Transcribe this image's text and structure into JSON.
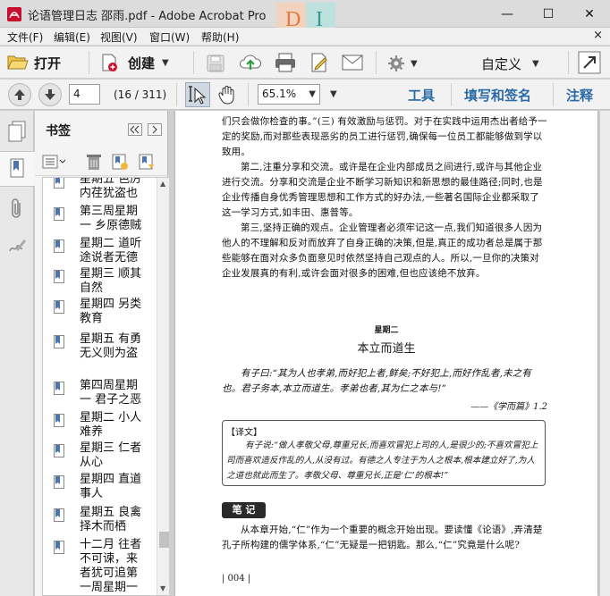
{
  "window": {
    "title": "论语管理日志 邵雨.pdf - Adobe Acrobat Pro",
    "watermark": "DI",
    "controls": {
      "minimize": "—",
      "maximize": "☐",
      "close": "✕"
    }
  },
  "menu": {
    "items": [
      "文件(F)",
      "编辑(E)",
      "视图(V)",
      "窗口(W)",
      "帮助(H)"
    ],
    "close_doc": "×"
  },
  "toolbar": {
    "open_label": "打开",
    "create_label": "创建",
    "custom_label": "自定义"
  },
  "nav": {
    "page_value": "4",
    "page_info": "(16 / 311)",
    "zoom_value": "65.1%",
    "tools_label": "工具",
    "fill_sign_label": "填写和签名",
    "comment_label": "注释"
  },
  "bookmarks": {
    "title": "书签",
    "items": [
      "星期五 色厉内荏犹盗也",
      "第三周星期一 乡原德贼",
      "星期二 道听途说者无德",
      "星期三 顺其自然",
      "星期四 另类教育",
      "星期五 有勇无义则为盗",
      "第四周星期一 君子之恶",
      "星期二 小人难养",
      "星期三 仁者从心",
      "星期四 直道事人",
      "星期五 良禽择木而栖",
      "十二月 往者不可谏，来者犹可追第一周星期一"
    ]
  },
  "document": {
    "para1": "们只会做你检查的事。”(三) 有效激励与惩罚。对于在实践中运用杰出者给予一定的奖励,而对那些表现恶劣的员工进行惩罚,确保每一位员工都能够做到学以致用。",
    "para2": "第二,注重分享和交流。或许是在企业内部成员之间进行,或许与其他企业进行交流。分享和交流是企业不断学习新知识和新思想的最佳路径;同时,也是企业传播自身优秀管理思想和工作方式的好办法,一些著名国际企业都采取了这一学习方式,如丰田、惠普等。",
    "para3": "第三,坚持正确的观点。企业管理者必须牢记这一点,我们知道很多人因为他人的不理解和反对而放弃了自身正确的决策,但是,真正的成功者总是属于那些能够在面对众多负面意见时依然坚持自己观点的人。所以,一旦你的决策对企业发展真的有利,或许会面对很多的困难,但也应该绝不放弃。",
    "day_heading": "星期二",
    "section_title": "本立而道生",
    "quote": "有子曰:“其为人也孝弟,而好犯上者,鲜矣;不好犯上,而好作乱者,未之有也。君子务本,本立而道生。孝弟也者,其为仁之本与!”",
    "quote_source": "——《学而篇》1.2",
    "translation_label": "【译文】",
    "translation": "有子说:“做人孝敬父母,尊重兄长,而喜欢冒犯上司的人,是很少的;不喜欢冒犯上司而喜欢造反作乱的人,从没有过。有德之人专注于为人之根本,根本建立好了,为人之道也就此而生了。孝敬父母、尊重兄长,正是‘仁’的根本!”",
    "notes_label": "笔 记",
    "notes_text": "从本章开始,“仁”作为一个重要的概念开始出现。要读懂《论语》,弄清楚孔子所构建的儒学体系,“仁”无疑是一把钥匙。那么,“仁”究竟是什么呢?",
    "page_number": "| 004 |"
  },
  "colors": {
    "accent_blue": "#2b6aa6",
    "pdf_red": "#c8102e",
    "bookmark_blue": "#4a74b4"
  }
}
